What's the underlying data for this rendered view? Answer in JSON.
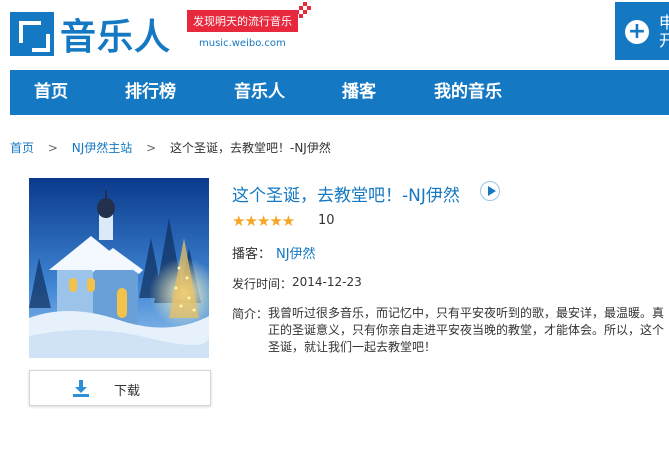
{
  "brand": {
    "logo_text": "音乐人",
    "slogan": "发现明天的流行音乐",
    "domain": "music.weibo.com",
    "accent": "#1478c3",
    "slogan_color": "#e8283c"
  },
  "top_button": {
    "label": "申\n开",
    "icon": "plus-icon"
  },
  "nav": {
    "items": [
      "首页",
      "排行榜",
      "音乐人",
      "播客",
      "我的音乐"
    ]
  },
  "breadcrumb": {
    "home": "首页",
    "station": "NJ伊然主站",
    "current": "这个圣诞，去教堂吧！-NJ伊然",
    "separator": ">"
  },
  "album": {
    "title": "这个圣诞，去教堂吧！-NJ伊然",
    "rating_stars": 5,
    "rating_value": "10",
    "host_label": "播客：",
    "host_name": "NJ伊然",
    "date_label": "发行时间：",
    "date": "2014-12-23",
    "desc_label": "简介：",
    "description": "我曾听过很多音乐，而记忆中，只有平安夜听到的歌，最安详，最温暖。真正的圣诞意义，只有你亲自走进平安夜当晚的教堂，才能体会。所以，这个圣诞，就让我们一起去教堂吧！"
  },
  "download": {
    "label": "下载",
    "icon": "download-icon"
  }
}
